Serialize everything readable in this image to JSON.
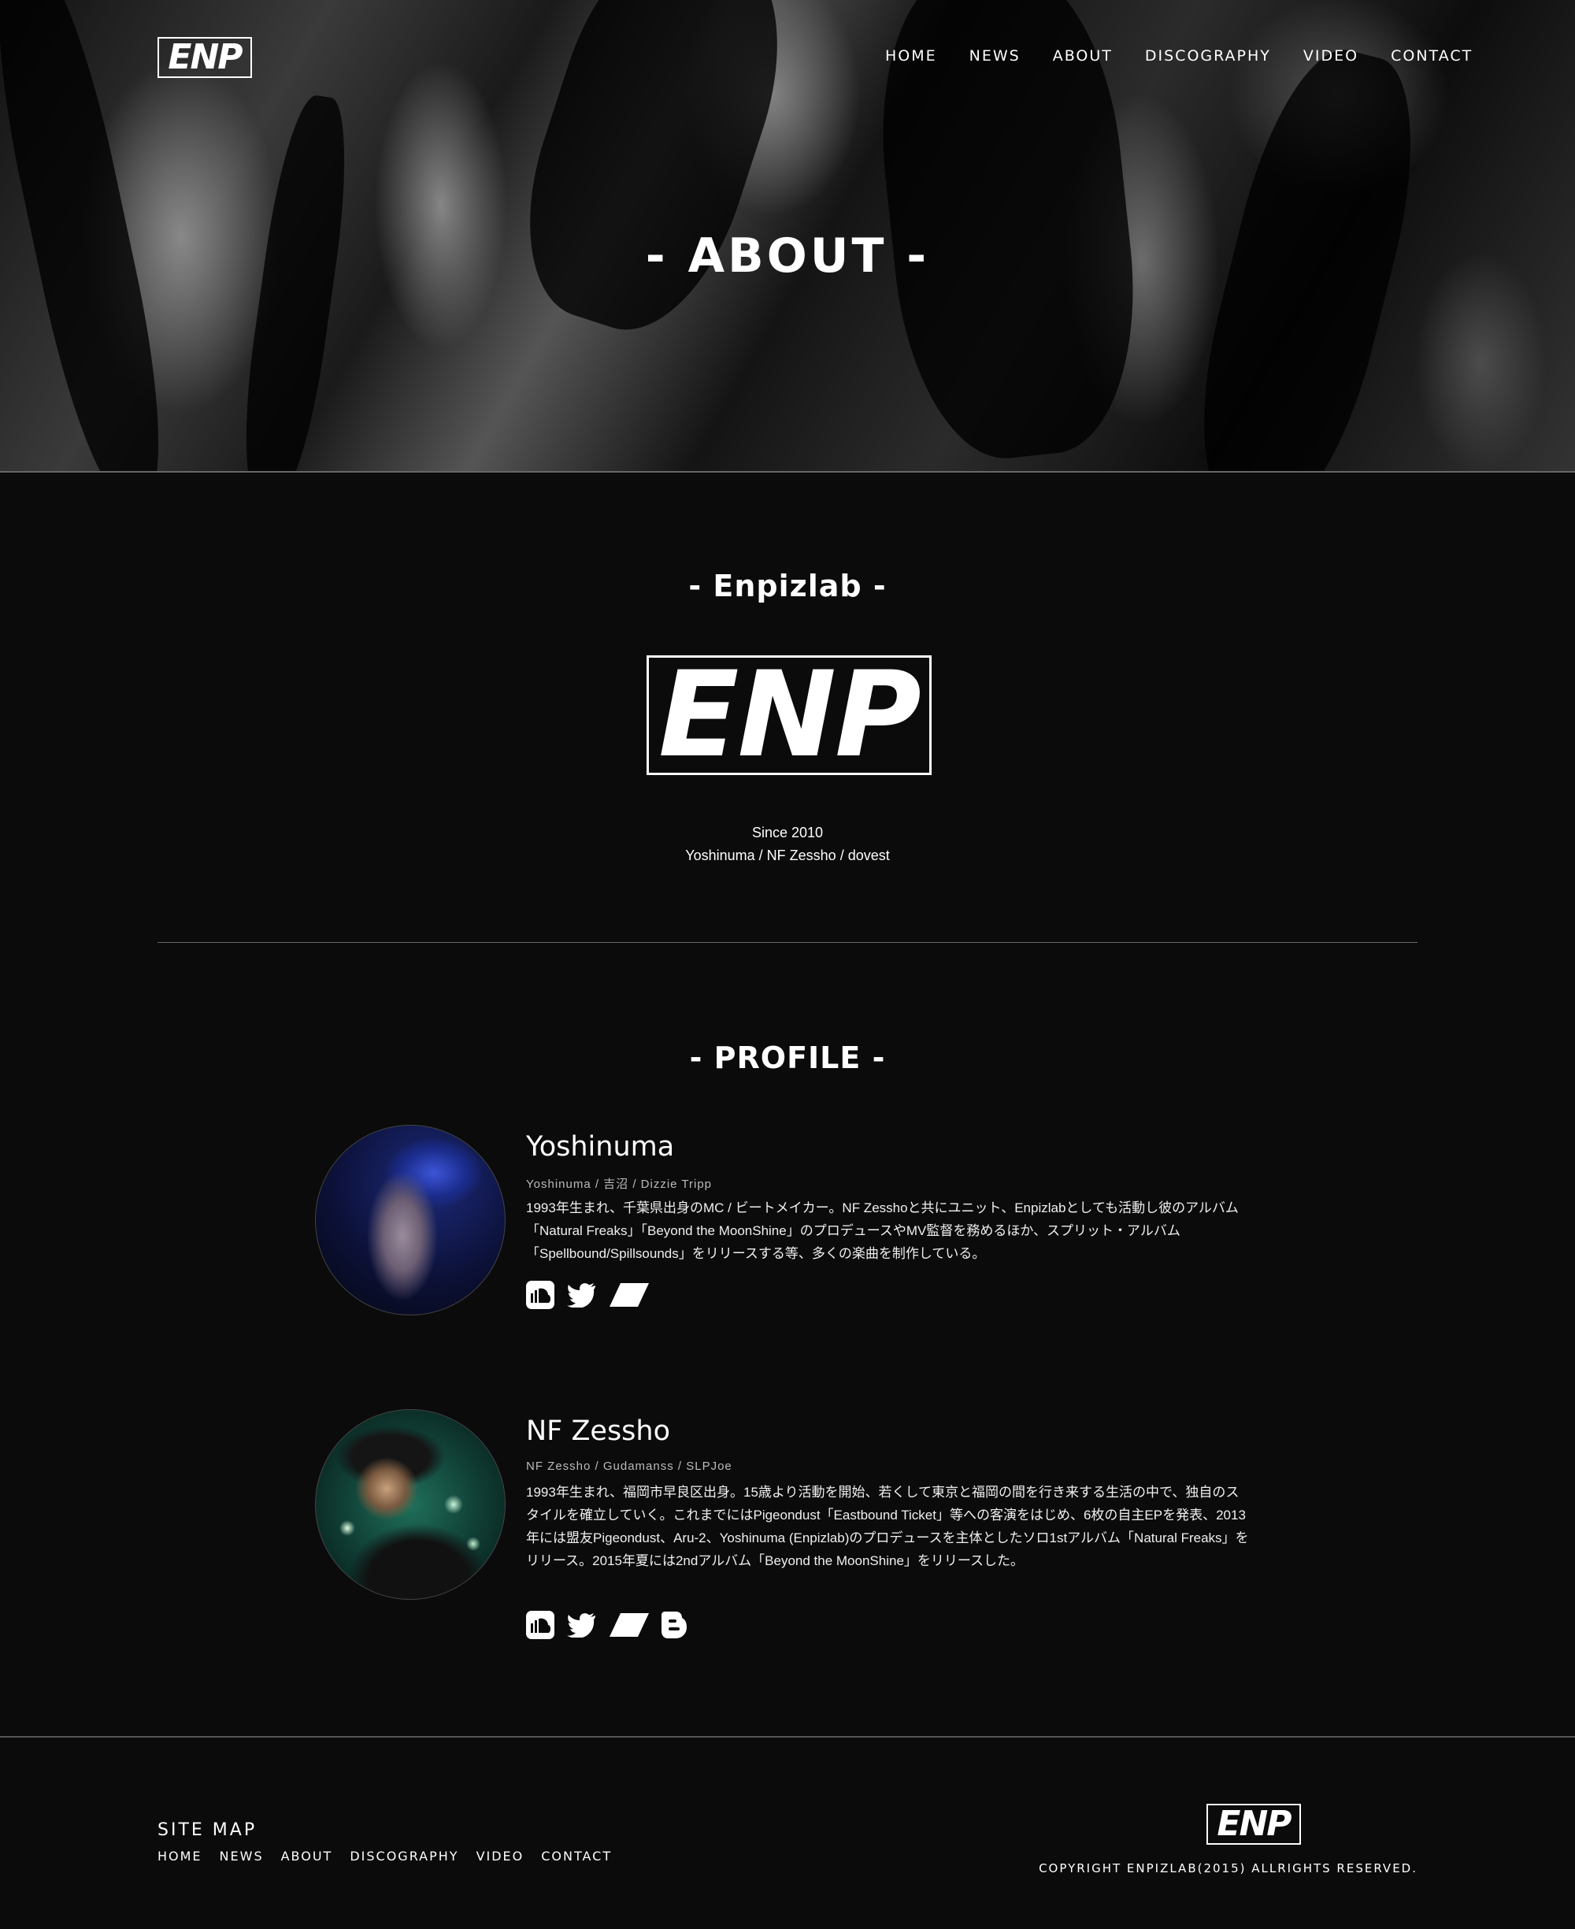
{
  "brand": {
    "logo_text": "ENP"
  },
  "nav": {
    "items": [
      "HOME",
      "NEWS",
      "ABOUT",
      "DISCOGRAPHY",
      "VIDEO",
      "CONTACT"
    ]
  },
  "hero": {
    "title": "- ABOUT -"
  },
  "about": {
    "title": "- Enpizlab -",
    "since": "Since 2010",
    "members": "Yoshinuma / NF Zessho / dovest"
  },
  "profile": {
    "title": "- PROFILE -",
    "people": [
      {
        "name": "Yoshinuma",
        "aliases": "Yoshinuma / 吉沼 / Dizzie Tripp",
        "bio": "1993年生まれ、千葉県出身のMC / ビートメイカー。NF Zesshoと共にユニット、Enpizlabとしても活動し彼のアルバム「Natural Freaks」「Beyond the MoonShine」のプロデュースやMV監督を務めるほか、スプリット・アルバム「Spellbound/Spillsounds」をリリースする等、多くの楽曲を制作している。",
        "icons": [
          "soundcloud-icon",
          "twitter-icon",
          "parallelogram-icon"
        ]
      },
      {
        "name": "NF Zessho",
        "aliases": "NF Zessho / Gudamanss / SLPJoe",
        "bio": "1993年生まれ、福岡市早良区出身。15歳より活動を開始、若くして東京と福岡の間を行き来する生活の中で、独自のスタイルを確立していく。これまでにはPigeondust「Eastbound Ticket」等への客演をはじめ、6枚の自主EPを発表、2013年には盟友Pigeondust、Aru-2、Yoshinuma (Enpizlab)のプロデュースを主体としたソロ1stアルバム「Natural Freaks」をリリース。2015年夏には2ndアルバム「Beyond the MoonShine」をリリースした。",
        "icons": [
          "soundcloud-icon",
          "twitter-icon",
          "parallelogram-icon",
          "blogger-icon"
        ]
      }
    ]
  },
  "footer": {
    "sitemap_title": "SITE MAP",
    "nav": [
      "HOME",
      "NEWS",
      "ABOUT",
      "DISCOGRAPHY",
      "VIDEO",
      "CONTACT"
    ],
    "copyright": "COPYRIGHT ENPIZLAB(2015) ALLRIGHTS RESERVED."
  }
}
